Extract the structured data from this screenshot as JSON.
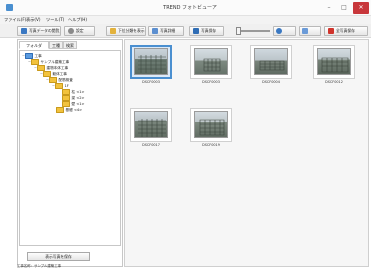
{
  "window": {
    "title": "TREND フォトビューア",
    "controls": {
      "minimize": "–",
      "maximize": "□",
      "close": "✕"
    }
  },
  "menu": [
    {
      "label": "ファイル(F)"
    },
    {
      "label": "表示(V)"
    },
    {
      "label": "ツール(T)"
    },
    {
      "label": "ヘルプ(H)"
    }
  ],
  "toolbar": {
    "buttons": [
      {
        "label": "写真データの閲覧",
        "icon": "photo-folder-icon",
        "color": "#3a78c2"
      },
      {
        "label": "設定",
        "icon": "gear-icon",
        "color": "#8a8a8a"
      },
      {
        "label": "下位分類を表示",
        "icon": "folder-tree-icon",
        "color": "#e3b23c"
      },
      {
        "label": "写真詳細",
        "icon": "photo-detail-icon",
        "color": "#5c8fd0"
      },
      {
        "label": "写真保存",
        "icon": "save-photo-icon",
        "color": "#2f6db5"
      },
      {
        "label": "全写真保存",
        "icon": "save-all-icon",
        "color": "#d0342c"
      }
    ],
    "help_icon": "help-icon",
    "back_icon": "back-icon",
    "forward_icon": "forward-icon"
  },
  "left_pane": {
    "tabs": [
      {
        "label": "フォルダ",
        "active": true
      },
      {
        "label": "工種",
        "active": false
      },
      {
        "label": "検索",
        "active": false
      }
    ],
    "tree": [
      {
        "label": "工事",
        "level": 0,
        "expander": "−"
      },
      {
        "label": "サンプル建築工事",
        "level": 1,
        "expander": "−"
      },
      {
        "label": "建物本体工事",
        "level": 2,
        "expander": "−"
      },
      {
        "label": "躯体工事",
        "level": 3,
        "expander": "−"
      },
      {
        "label": "配筋検査",
        "level": 4,
        "expander": "−"
      },
      {
        "label": "1F",
        "level": 5,
        "expander": "−"
      },
      {
        "label": "柱 <1>",
        "level": 6,
        "expander": ""
      },
      {
        "label": "梁 <2>",
        "level": 6,
        "expander": ""
      },
      {
        "label": "壁 <1>",
        "level": 6,
        "expander": ""
      },
      {
        "label": "基礎 <4>",
        "level": 5,
        "expander": ""
      }
    ],
    "show_selected_button": "表示写真を保存"
  },
  "status_bar": "工事名称：サンプル建築工事",
  "photos": [
    {
      "caption": "DSCF0003",
      "selected": true
    },
    {
      "caption": "DSCF0003",
      "selected": false
    },
    {
      "caption": "DSCF0004",
      "selected": false
    },
    {
      "caption": "DSCF0012",
      "selected": false
    },
    {
      "caption": "DSCF0017",
      "selected": false
    },
    {
      "caption": "DSCF0019",
      "selected": false
    }
  ]
}
